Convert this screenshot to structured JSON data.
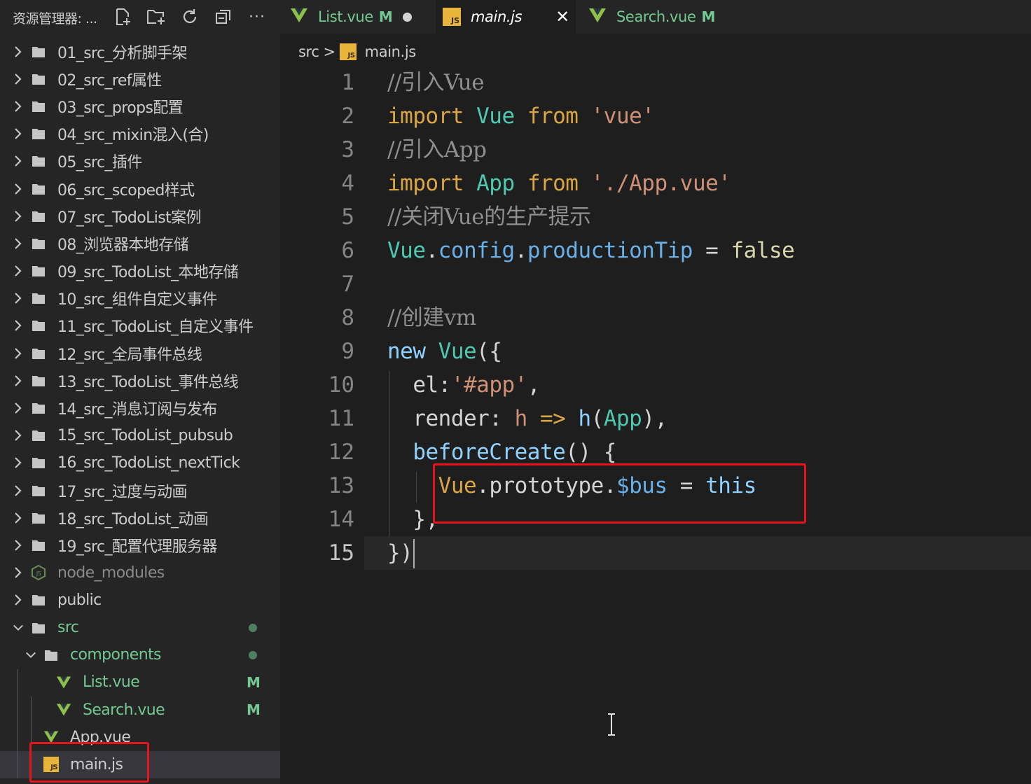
{
  "sidebar": {
    "title": "资源管理器: ...",
    "actions": [
      "new-file-icon",
      "new-folder-icon",
      "refresh-icon",
      "collapse-all-icon",
      "more-icon"
    ],
    "more_label": "···",
    "folders": [
      "01_src_分析脚手架",
      "02_src_ref属性",
      "03_src_props配置",
      "04_src_mixin混入(合)",
      "05_src_插件",
      "06_src_scoped样式",
      "07_src_TodoList案例",
      "08_浏览器本地存储",
      "09_src_TodoList_本地存储",
      "10_src_组件自定义事件",
      "11_src_TodoList_自定义事件",
      "12_src_全局事件总线",
      "13_src_TodoList_事件总线",
      "14_src_消息订阅与发布",
      "15_src_TodoList_pubsub",
      "16_src_TodoList_nextTick",
      "17_src_过度与动画",
      "18_src_TodoList_动画",
      "19_src_配置代理服务器"
    ],
    "node_modules": "node_modules",
    "public": "public",
    "src": "src",
    "components": "components",
    "list_vue": "List.vue",
    "search_vue": "Search.vue",
    "app_vue": "App.vue",
    "main_js": "main.js",
    "modified_badge": "M",
    "js_badge": "JS"
  },
  "tabs": [
    {
      "name": "List.vue",
      "status": "M",
      "icon": "vue-icon"
    },
    {
      "name": "main.js",
      "status": "",
      "icon": "js-icon",
      "active": true
    },
    {
      "name": "Search.vue",
      "status": "M",
      "icon": "vue-icon"
    }
  ],
  "close_glyph": "✕",
  "breadcrumb": {
    "folder": "src",
    "separator": ">",
    "file": "main.js"
  },
  "editor": {
    "line_numbers": [
      "1",
      "2",
      "3",
      "4",
      "5",
      "6",
      "7",
      "8",
      "9",
      "10",
      "11",
      "12",
      "13",
      "14",
      "15"
    ],
    "current_line": 15,
    "highlighted_lines": [
      13,
      14
    ],
    "lines": [
      [
        {
          "t": "//引入Vue",
          "c": "cm"
        }
      ],
      [
        {
          "t": "import",
          "c": "kw"
        },
        {
          "t": " Vue ",
          "c": "cls"
        },
        {
          "t": "from",
          "c": "kw"
        },
        {
          "t": " 'vue'",
          "c": "str"
        }
      ],
      [
        {
          "t": "//引入App",
          "c": "cm"
        }
      ],
      [
        {
          "t": "import",
          "c": "kw"
        },
        {
          "t": " App ",
          "c": "cls"
        },
        {
          "t": "from",
          "c": "kw"
        },
        {
          "t": " './App.vue'",
          "c": "str"
        }
      ],
      [
        {
          "t": "//关闭Vue的生产提示",
          "c": "cm"
        }
      ],
      [
        {
          "t": "Vue",
          "c": "cls"
        },
        {
          "t": ".",
          "c": "plain"
        },
        {
          "t": "config",
          "c": "prop"
        },
        {
          "t": ".",
          "c": "plain"
        },
        {
          "t": "productionTip",
          "c": "prop"
        },
        {
          "t": " = ",
          "c": "plain"
        },
        {
          "t": "false",
          "c": "bool"
        }
      ],
      [],
      [
        {
          "t": "//创建vm",
          "c": "cm"
        }
      ],
      [
        {
          "t": "new",
          "c": "fn"
        },
        {
          "t": " ",
          "c": "plain"
        },
        {
          "t": "Vue",
          "c": "cls"
        },
        {
          "t": "({",
          "c": "plain"
        }
      ],
      [
        {
          "t": "  el",
          "c": "key"
        },
        {
          "t": ":",
          "c": "plain"
        },
        {
          "t": "'#app'",
          "c": "str"
        },
        {
          "t": ",",
          "c": "plain"
        }
      ],
      [
        {
          "t": "  render",
          "c": "key"
        },
        {
          "t": ": ",
          "c": "plain"
        },
        {
          "t": "h",
          "c": "str"
        },
        {
          "t": " => ",
          "c": "kw"
        },
        {
          "t": "h",
          "c": "fn"
        },
        {
          "t": "(",
          "c": "plain"
        },
        {
          "t": "App",
          "c": "cls"
        },
        {
          "t": "),",
          "c": "plain"
        }
      ],
      [
        {
          "t": "  ",
          "c": "plain"
        },
        {
          "t": "beforeCreate",
          "c": "fn"
        },
        {
          "t": "() {",
          "c": "plain"
        }
      ],
      [
        {
          "t": "    ",
          "c": "plain"
        },
        {
          "t": "Vue",
          "c": "kw"
        },
        {
          "t": ".",
          "c": "plain"
        },
        {
          "t": "prototype",
          "c": "key"
        },
        {
          "t": ".",
          "c": "plain"
        },
        {
          "t": "$bus",
          "c": "prop"
        },
        {
          "t": " = ",
          "c": "plain"
        },
        {
          "t": "this",
          "c": "fn"
        }
      ],
      [
        {
          "t": "  },",
          "c": "plain"
        }
      ],
      [
        {
          "t": "})",
          "c": "plain"
        }
      ]
    ]
  },
  "colors": {
    "highlight_box": "#e8141b",
    "modified": "#73c991",
    "js_icon": "#e8b43a",
    "vue_icon": "#8dc149"
  }
}
